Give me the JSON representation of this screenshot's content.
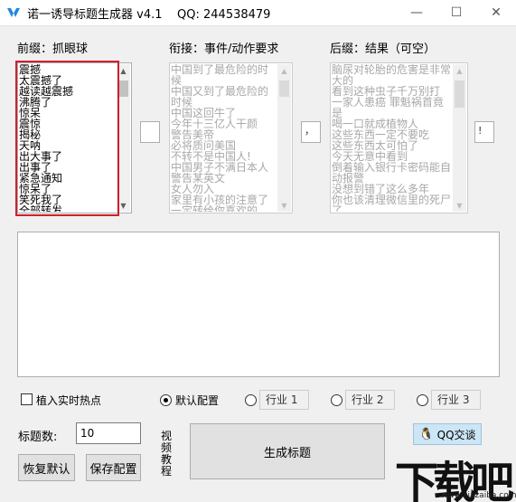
{
  "window": {
    "title": "诺一诱导标题生成器 v4.1    QQ: 244538479",
    "minimize_symbol": "—",
    "maximize_symbol": "☐",
    "close_symbol": "✕"
  },
  "columns": {
    "prefix": {
      "label": "前缀：抓眼球",
      "items": [
        "震撼",
        "太震撼了",
        "越读越震撼",
        "沸腾了",
        "惊呆",
        "震惊",
        "揭秘",
        "天呐",
        "出大事了",
        "出事了",
        "紧急通知",
        "惊呆了",
        "笑死我了",
        "全部转发"
      ],
      "separator": ""
    },
    "middle": {
      "label": "衔接：事件/动作要求",
      "items": [
        "中国到了最危险的时",
        "候",
        "中国又到了最危险的",
        "时候",
        "中国这回牛了",
        "今年十三亿人干颜",
        "警告美帝",
        "必将质问美国",
        "不转不是中国人!",
        "中国男子不满日本人",
        "警告某英文",
        "女人勿入",
        "家里有小孩的注意了",
        "一定转给你喜欢的"
      ],
      "separator": "，"
    },
    "suffix": {
      "label": "后缀：结果（可空）",
      "items": [
        "脑尿对轮胎的危害是非常",
        "大的",
        "看到这种虫子千万别打",
        "一家人患癌 罪魁祸首竟",
        "是",
        "喝一口就成植物人",
        "这些东西一定不要吃",
        "这些东西太可怕了",
        "今天无意中看到",
        "倒着输入银行卡密码能自",
        "动报警",
        "没想到错了这么多年",
        "你也该清理微信里的死尸",
        "了"
      ],
      "separator": "!"
    }
  },
  "options": {
    "realtime_label": "植入实时热点",
    "radio_default": "默认配置",
    "radio_industry1": "行业",
    "field_industry1": "行业 1",
    "radio_industry2": "行业",
    "field_industry2": "行业 2",
    "radio_industry3": "行业",
    "field_industry3": "行业 3"
  },
  "controls": {
    "count_label": "标题数:",
    "count_value": "10",
    "restore_label": "恢复默认",
    "save_label": "保存配置",
    "video_tutorial_label": "视频教程",
    "generate_label": "生成标题",
    "qq_label": "QQ交谈"
  },
  "watermark": {
    "logo": "下载吧",
    "url": "www.xiazaiba.com"
  },
  "colors": {
    "highlight_border": "#d0202a",
    "window_bg": "#f0f0f0",
    "disabled_text": "#a8a8a8"
  }
}
